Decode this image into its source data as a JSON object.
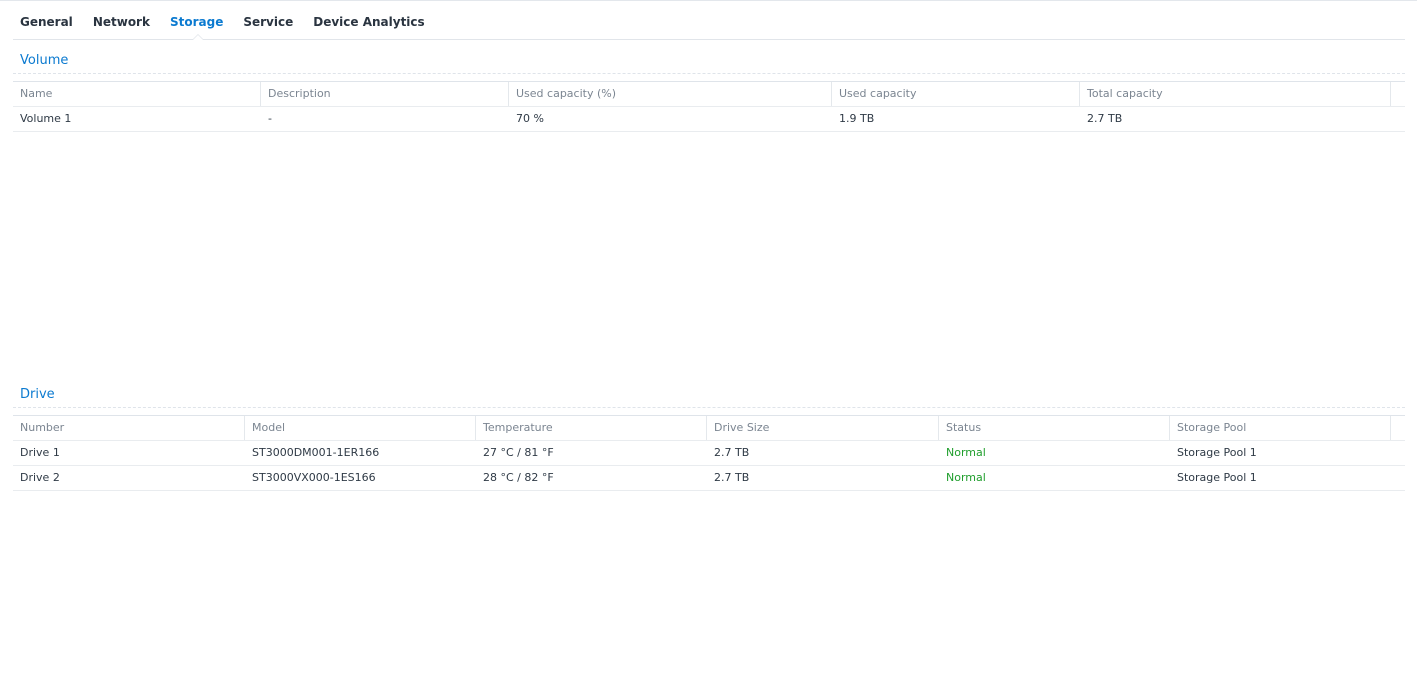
{
  "tabs": [
    {
      "label": "General",
      "active": false
    },
    {
      "label": "Network",
      "active": false
    },
    {
      "label": "Storage",
      "active": true
    },
    {
      "label": "Service",
      "active": false
    },
    {
      "label": "Device Analytics",
      "active": false
    }
  ],
  "volume": {
    "title": "Volume",
    "columns": [
      "Name",
      "Description",
      "Used capacity (%)",
      "Used capacity",
      "Total capacity"
    ],
    "rows": [
      {
        "name": "Volume 1",
        "description": "-",
        "used_pct": "70 %",
        "used": "1.9 TB",
        "total": "2.7 TB"
      }
    ]
  },
  "drive": {
    "title": "Drive",
    "columns": [
      "Number",
      "Model",
      "Temperature",
      "Drive Size",
      "Status",
      "Storage Pool"
    ],
    "rows": [
      {
        "number": "Drive 1",
        "model": "ST3000DM001-1ER166",
        "temperature": "27 °C / 81 °F",
        "size": "2.7 TB",
        "status": "Normal",
        "pool": "Storage Pool 1"
      },
      {
        "number": "Drive 2",
        "model": "ST3000VX000-1ES166",
        "temperature": "28 °C / 82 °F",
        "size": "2.7 TB",
        "status": "Normal",
        "pool": "Storage Pool 1"
      }
    ]
  },
  "colors": {
    "accent": "#0b7ad0",
    "status_normal": "#1f9e2c"
  }
}
